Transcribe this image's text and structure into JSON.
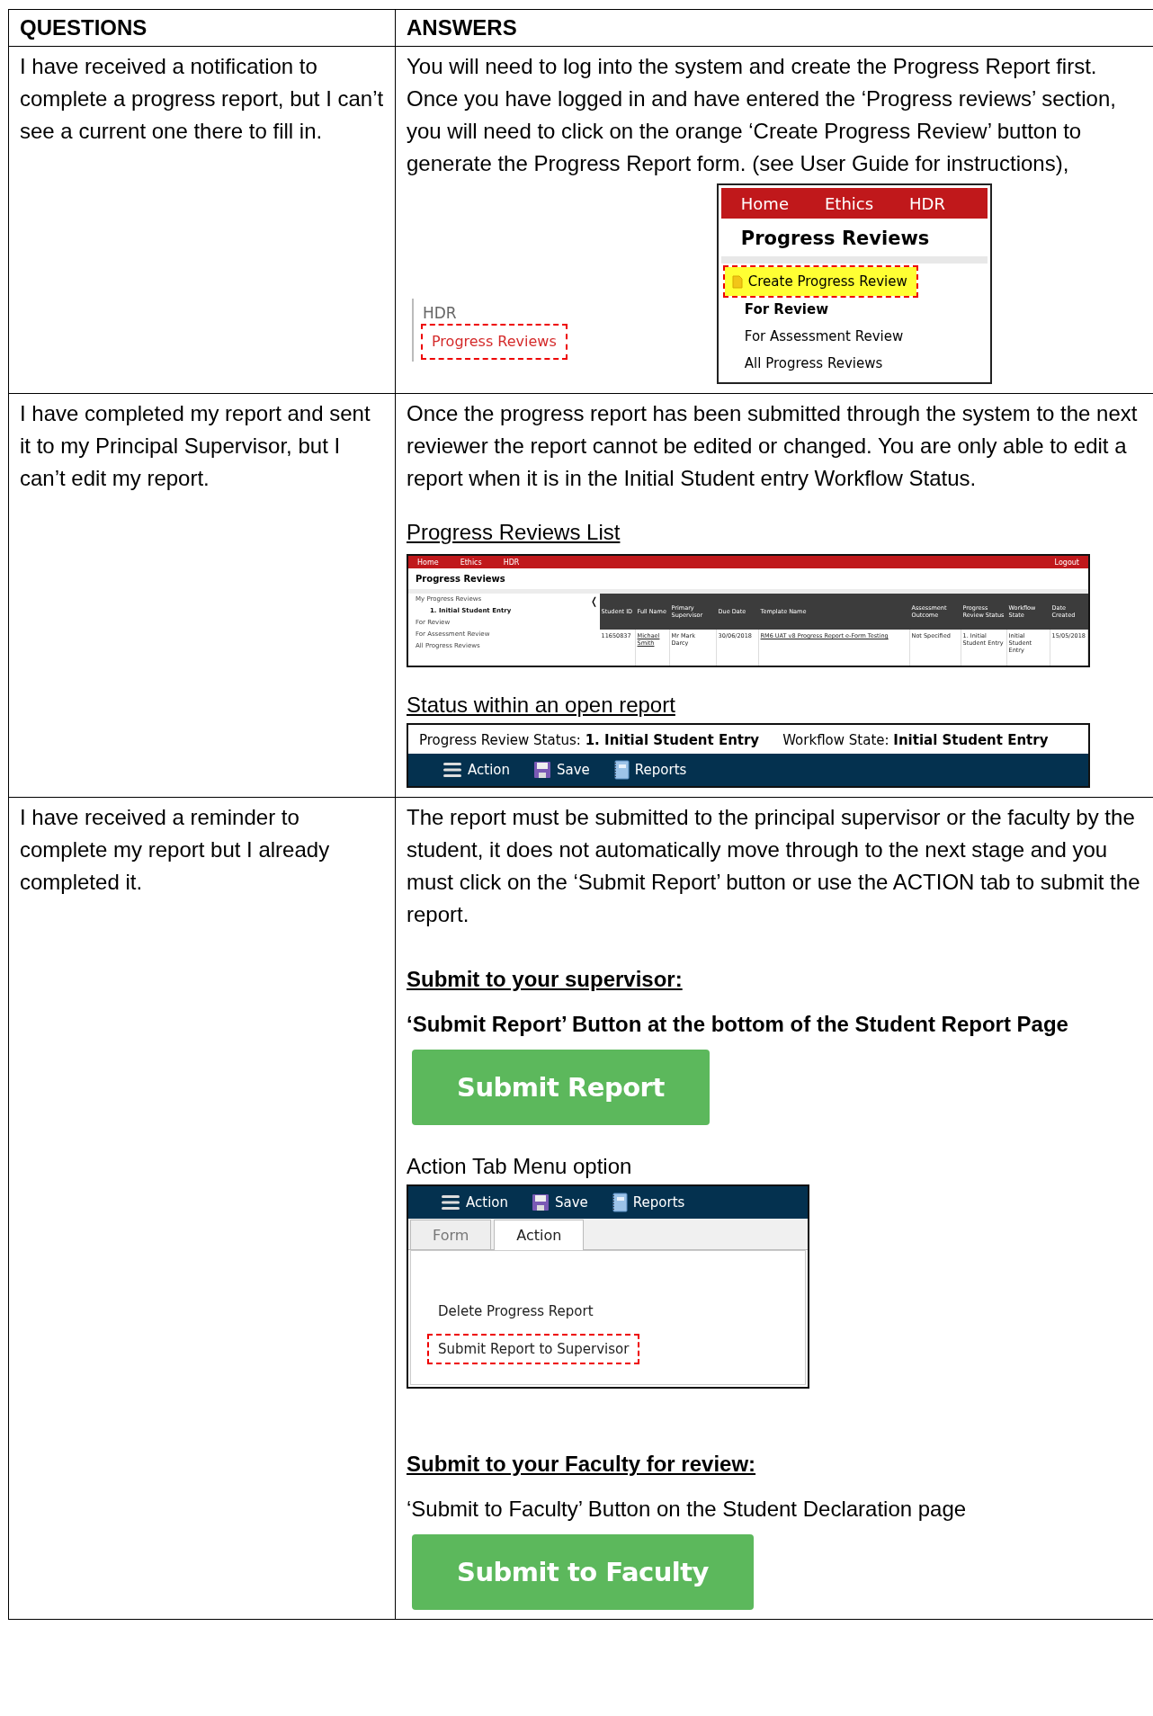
{
  "table": {
    "columns": [
      "QUESTIONS",
      "ANSWERS"
    ],
    "rows": [
      {
        "question": "I have received a notification to complete a progress report, but I can’t see a current one there to fill in.",
        "answer": [
          {
            "kind": "text",
            "text": "You will need to log into the system and create the Progress Report first. Once you have logged in and have entered the ‘Progress reviews’ section, you will need to click on the orange ‘Create Progress Review’ button to generate the Progress Report form. (see User Guide for instructions),"
          },
          {
            "kind": "nav_figure",
            "sidebar": {
              "section": "HDR",
              "item": "Progress Reviews",
              "highlighted": true
            },
            "menu": {
              "nav": [
                "Home",
                "Ethics",
                "HDR"
              ],
              "title": "Progress Reviews",
              "items": [
                {
                  "label": "Create Progress Review",
                  "highlighted": true,
                  "bold": false
                },
                {
                  "label": "For Review",
                  "highlighted": false,
                  "bold": true
                },
                {
                  "label": "For Assessment Review",
                  "highlighted": false,
                  "bold": false
                },
                {
                  "label": "All Progress Reviews",
                  "highlighted": false,
                  "bold": false
                }
              ]
            }
          }
        ]
      },
      {
        "question": "I have completed my report and sent it to my Principal Supervisor, but I can’t edit my report.",
        "answer": [
          {
            "kind": "text",
            "text": "Once the progress report has been submitted through the system to the next reviewer the report cannot be edited or changed. You are only able to edit a report when it is in the Initial Student entry Workflow Status."
          },
          {
            "kind": "link_heading",
            "text": "Progress Reviews List"
          },
          {
            "kind": "list_screenshot",
            "nav": [
              "Home",
              "Ethics",
              "HDR"
            ],
            "logout": "Logout",
            "title": "Progress Reviews",
            "collapse": "❬",
            "sidebar": [
              {
                "label": "My Progress Reviews",
                "bold": false,
                "children": [
                  {
                    "label": "1. Initial Student Entry",
                    "bold": true
                  }
                ]
              },
              {
                "label": "For Review",
                "bold": false
              },
              {
                "label": "For Assessment Review",
                "bold": false
              },
              {
                "label": "All Progress Reviews",
                "bold": false
              }
            ],
            "columns": [
              "Student ID",
              "Full Name",
              "Primary Supervisor",
              "Due Date",
              "Template Name",
              "Assessment Outcome",
              "Progress Review Status",
              "Workflow State",
              "Date Created"
            ],
            "rows": [
              [
                {
                  "text": "11650837",
                  "link": false
                },
                {
                  "text": "Michael Smith",
                  "link": true
                },
                {
                  "text": "Mr Mark Darcy",
                  "link": false
                },
                {
                  "text": "30/06/2018",
                  "link": false
                },
                {
                  "text": "RM6 UAT v8 Progress Report e-Form Testing",
                  "link": true
                },
                {
                  "text": "Not Specified",
                  "link": false
                },
                {
                  "text": "1. Initial Student Entry",
                  "link": false
                },
                {
                  "text": "Initial Student Entry",
                  "link": false
                },
                {
                  "text": "15/05/2018",
                  "link": false
                }
              ]
            ]
          },
          {
            "kind": "link_heading",
            "text": "Status within an open report"
          },
          {
            "kind": "status_screenshot",
            "status": "Progress Review Status: **1. Initial Student Entry**",
            "workflow": "Workflow State: **Initial Student Entry**",
            "toolbar": [
              {
                "kind": "menu",
                "label": "Action"
              },
              {
                "kind": "save",
                "label": "Save"
              },
              {
                "kind": "notebook",
                "label": "Reports"
              }
            ]
          }
        ]
      },
      {
        "question": "I have received a reminder to complete my report but I already completed it.",
        "answer": [
          {
            "kind": "text",
            "text": "The report must be submitted to the principal supervisor or the faculty by the student, it does not automatically move through to the next stage and you must click on the ‘Submit Report’ button or use the ACTION tab to submit the report."
          },
          {
            "kind": "heading",
            "text": "Submit to your supervisor:"
          },
          {
            "kind": "bold_text",
            "text": "‘Submit Report’ Button at the bottom of the Student Report Page"
          },
          {
            "kind": "green_button",
            "text": "Submit Report"
          },
          {
            "kind": "caption",
            "text": "Action Tab Menu option"
          },
          {
            "kind": "action_screenshot",
            "toolbar": [
              {
                "kind": "menu",
                "label": "Action"
              },
              {
                "kind": "save",
                "label": "Save"
              },
              {
                "kind": "notebook",
                "label": "Reports"
              }
            ],
            "tabs": [
              {
                "label": "Form",
                "selected": false
              },
              {
                "label": "Action",
                "selected": true
              }
            ],
            "items": [
              {
                "label": "Delete Progress Report",
                "highlighted": false
              },
              {
                "label": "Submit Report to Supervisor",
                "highlighted": true
              }
            ]
          },
          {
            "kind": "heading",
            "text": "Submit to your Faculty for review:"
          },
          {
            "kind": "caption",
            "text": "‘Submit to Faculty’ Button on the Student Declaration page"
          },
          {
            "kind": "green_button",
            "text": "Submit to Faculty"
          }
        ]
      }
    ]
  }
}
